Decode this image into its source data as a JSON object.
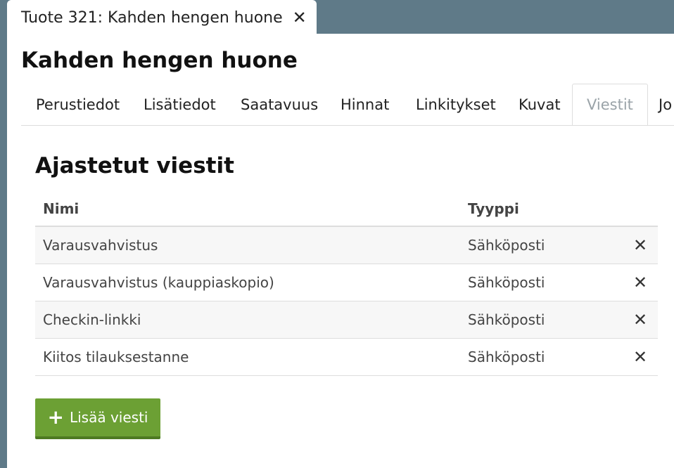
{
  "window_tab": {
    "title": "Tuote 321: Kahden hengen huone",
    "close_glyph": "✕"
  },
  "page": {
    "title": "Kahden hengen huone"
  },
  "tabs": [
    {
      "label": "Perustiedot"
    },
    {
      "label": "Lisätiedot"
    },
    {
      "label": "Saatavuus"
    },
    {
      "label": "Hinnat"
    },
    {
      "label": "Linkitykset"
    },
    {
      "label": "Kuvat"
    },
    {
      "label": "Viestit",
      "active": true
    },
    {
      "label": "Jo"
    }
  ],
  "section": {
    "title": "Ajastetut viestit"
  },
  "table": {
    "headers": {
      "name": "Nimi",
      "type": "Tyyppi"
    },
    "rows": [
      {
        "name": "Varausvahvistus",
        "type": "Sähköposti"
      },
      {
        "name": "Varausvahvistus (kauppiaskopio)",
        "type": "Sähköposti"
      },
      {
        "name": "Checkin-linkki",
        "type": "Sähköposti"
      },
      {
        "name": "Kiitos tilauksestanne",
        "type": "Sähköposti"
      }
    ],
    "delete_glyph": "✕"
  },
  "add_button": {
    "icon": "plus-icon",
    "glyph": "+",
    "label": "Lisää viesti"
  },
  "colors": {
    "header_bg": "#5f7a88",
    "button_green": "#6ca034",
    "active_tab_text": "#9aa3a8"
  }
}
